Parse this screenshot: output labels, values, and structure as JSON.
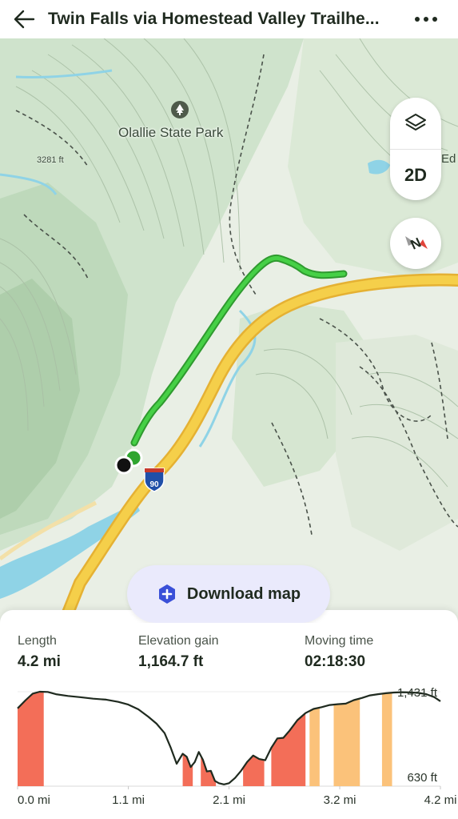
{
  "header": {
    "title": "Twin Falls via Homestead Valley Trailhe...",
    "back_icon": "arrow-left-icon",
    "more_icon": "more-horizontal-icon"
  },
  "map": {
    "park_name": "Olallie State Park",
    "peak_elevation": "3281 ft",
    "edge_label": "Ed",
    "highway_shield": "90",
    "mode_label": "2D",
    "layers_icon": "layers-icon",
    "compass_icon": "compass-icon",
    "download_label": "Download map",
    "download_icon": "download-badge-icon",
    "colors": {
      "trail": "#2fb82f",
      "highway": "#f0c33a",
      "water": "#8fd3e6",
      "forest": "#cfe6cf",
      "terrain": "#e8efe4",
      "start_marker": "#2fa52f",
      "end_marker": "#111111"
    }
  },
  "stats": {
    "length": {
      "label": "Length",
      "value": "4.2 mi"
    },
    "elevation_gain": {
      "label": "Elevation gain",
      "value": "1,164.7 ft"
    },
    "moving_time": {
      "label": "Moving time",
      "value": "02:18:30"
    }
  },
  "chart_data": {
    "type": "area",
    "xlabel": "",
    "ylabel": "",
    "x_ticks": [
      "0.0 mi",
      "1.1 mi",
      "2.1 mi",
      "3.2 mi",
      "4.2 mi"
    ],
    "y_ticks": [
      "1,431 ft",
      "630 ft"
    ],
    "ylim": [
      630,
      1431
    ],
    "xlim": [
      0.0,
      4.2
    ],
    "x": [
      0.0,
      0.08,
      0.15,
      0.22,
      0.3,
      0.38,
      0.5,
      0.62,
      0.75,
      0.88,
      1.0,
      1.1,
      1.2,
      1.3,
      1.38,
      1.46,
      1.52,
      1.58,
      1.64,
      1.68,
      1.72,
      1.76,
      1.8,
      1.84,
      1.88,
      1.92,
      1.96,
      2.0,
      2.05,
      2.1,
      2.16,
      2.22,
      2.28,
      2.34,
      2.4,
      2.46,
      2.52,
      2.58,
      2.64,
      2.7,
      2.78,
      2.86,
      2.94,
      3.02,
      3.1,
      3.18,
      3.26,
      3.34,
      3.42,
      3.5,
      3.58,
      3.66,
      3.74,
      3.82,
      3.9,
      3.98,
      4.06,
      4.14,
      4.2
    ],
    "elevation_ft": [
      1290,
      1360,
      1415,
      1431,
      1429,
      1410,
      1395,
      1385,
      1372,
      1364,
      1345,
      1322,
      1282,
      1218,
      1160,
      1080,
      960,
      820,
      905,
      880,
      792,
      835,
      920,
      855,
      755,
      760,
      675,
      655,
      645,
      655,
      700,
      760,
      835,
      890,
      860,
      850,
      955,
      1035,
      1040,
      1100,
      1190,
      1250,
      1285,
      1300,
      1318,
      1325,
      1330,
      1360,
      1378,
      1400,
      1410,
      1418,
      1424,
      1427,
      1425,
      1421,
      1410,
      1385,
      1350
    ],
    "grade_segments": [
      {
        "from": 0.0,
        "to": 0.26,
        "level": "steep",
        "color": "#f36e58"
      },
      {
        "from": 1.64,
        "to": 1.74,
        "level": "steep",
        "color": "#f36e58"
      },
      {
        "from": 1.82,
        "to": 1.97,
        "level": "steep",
        "color": "#f36e58"
      },
      {
        "from": 2.24,
        "to": 2.45,
        "level": "steep",
        "color": "#f36e58"
      },
      {
        "from": 2.52,
        "to": 2.86,
        "level": "steep",
        "color": "#f36e58"
      },
      {
        "from": 2.9,
        "to": 3.0,
        "level": "moderate",
        "color": "#fbc27a"
      },
      {
        "from": 3.14,
        "to": 3.4,
        "level": "moderate",
        "color": "#fbc27a"
      },
      {
        "from": 3.62,
        "to": 3.72,
        "level": "moderate",
        "color": "#fbc27a"
      }
    ]
  }
}
